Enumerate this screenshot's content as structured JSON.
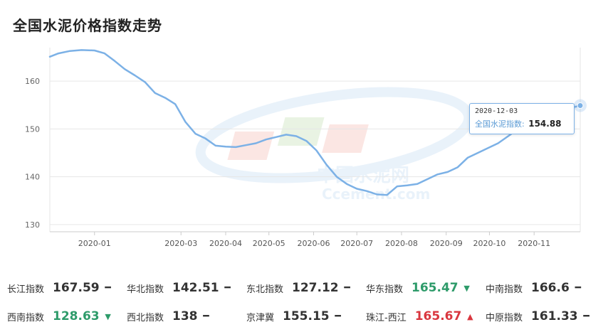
{
  "header": {
    "title": "全国水泥价格指数走势"
  },
  "tooltip": {
    "date": "2020-12-03",
    "name": "全国水泥指数:",
    "value": "154.88"
  },
  "chart_data": {
    "type": "line",
    "y_ticks": [
      130,
      140,
      150,
      160
    ],
    "ylim": [
      128.5,
      167
    ],
    "x_tick_labels": [
      "2020-01",
      "2020-03",
      "2020-04",
      "2020-05",
      "2020-06",
      "2020-07",
      "2020-08",
      "2020-09",
      "2020-10",
      "2020-11"
    ],
    "grid": "horizontal",
    "series": [
      {
        "color": "#7cb1e6",
        "x": [
          "2019-12-01",
          "2019-12-07",
          "2019-12-15",
          "2019-12-23",
          "2020-01-01",
          "2020-01-08",
          "2020-01-15",
          "2020-01-22",
          "2020-01-29",
          "2020-02-05",
          "2020-02-12",
          "2020-02-19",
          "2020-02-26",
          "2020-03-04",
          "2020-03-11",
          "2020-03-18",
          "2020-03-25",
          "2020-04-01",
          "2020-04-08",
          "2020-04-15",
          "2020-04-22",
          "2020-04-29",
          "2020-05-06",
          "2020-05-13",
          "2020-05-20",
          "2020-05-27",
          "2020-06-03",
          "2020-06-10",
          "2020-06-17",
          "2020-06-24",
          "2020-07-01",
          "2020-07-08",
          "2020-07-15",
          "2020-07-22",
          "2020-07-29",
          "2020-08-05",
          "2020-08-12",
          "2020-08-19",
          "2020-08-26",
          "2020-09-02",
          "2020-09-09",
          "2020-09-16",
          "2020-09-23",
          "2020-09-30",
          "2020-10-07",
          "2020-10-14",
          "2020-10-21",
          "2020-10-28",
          "2020-11-04",
          "2020-11-11",
          "2020-11-18",
          "2020-11-25",
          "2020-12-03"
        ],
        "y": [
          165.1,
          165.8,
          166.3,
          166.5,
          166.4,
          165.8,
          164.2,
          162.5,
          161.2,
          159.8,
          157.5,
          156.5,
          155.2,
          151.5,
          149.0,
          148.0,
          146.5,
          146.3,
          146.2,
          146.6,
          147.0,
          147.8,
          148.3,
          148.8,
          148.5,
          147.5,
          145.5,
          142.5,
          140.0,
          138.5,
          137.5,
          137.0,
          136.3,
          136.2,
          138.0,
          138.2,
          138.5,
          139.5,
          140.5,
          141.0,
          142.0,
          144.0,
          145.0,
          146.0,
          147.0,
          148.5,
          150.0,
          150.8,
          151.5,
          152.5,
          153.5,
          154.3,
          154.88
        ]
      }
    ]
  },
  "stats": [
    [
      {
        "name": "长江指数",
        "value": "167.59",
        "trend": "flat"
      },
      {
        "name": "华北指数",
        "value": "142.51",
        "trend": "flat"
      },
      {
        "name": "东北指数",
        "value": "127.12",
        "trend": "flat"
      },
      {
        "name": "华东指数",
        "value": "165.47",
        "trend": "down"
      },
      {
        "name": "中南指数",
        "value": "166.6",
        "trend": "flat"
      }
    ],
    [
      {
        "name": "西南指数",
        "value": "128.63",
        "trend": "down"
      },
      {
        "name": "西北指数",
        "value": "138",
        "trend": "flat"
      },
      {
        "name": "京津冀",
        "value": "155.15",
        "trend": "flat"
      },
      {
        "name": "珠江-西江",
        "value": "165.67",
        "trend": "up"
      },
      {
        "name": "中原指数",
        "value": "161.33",
        "trend": "flat"
      }
    ]
  ]
}
